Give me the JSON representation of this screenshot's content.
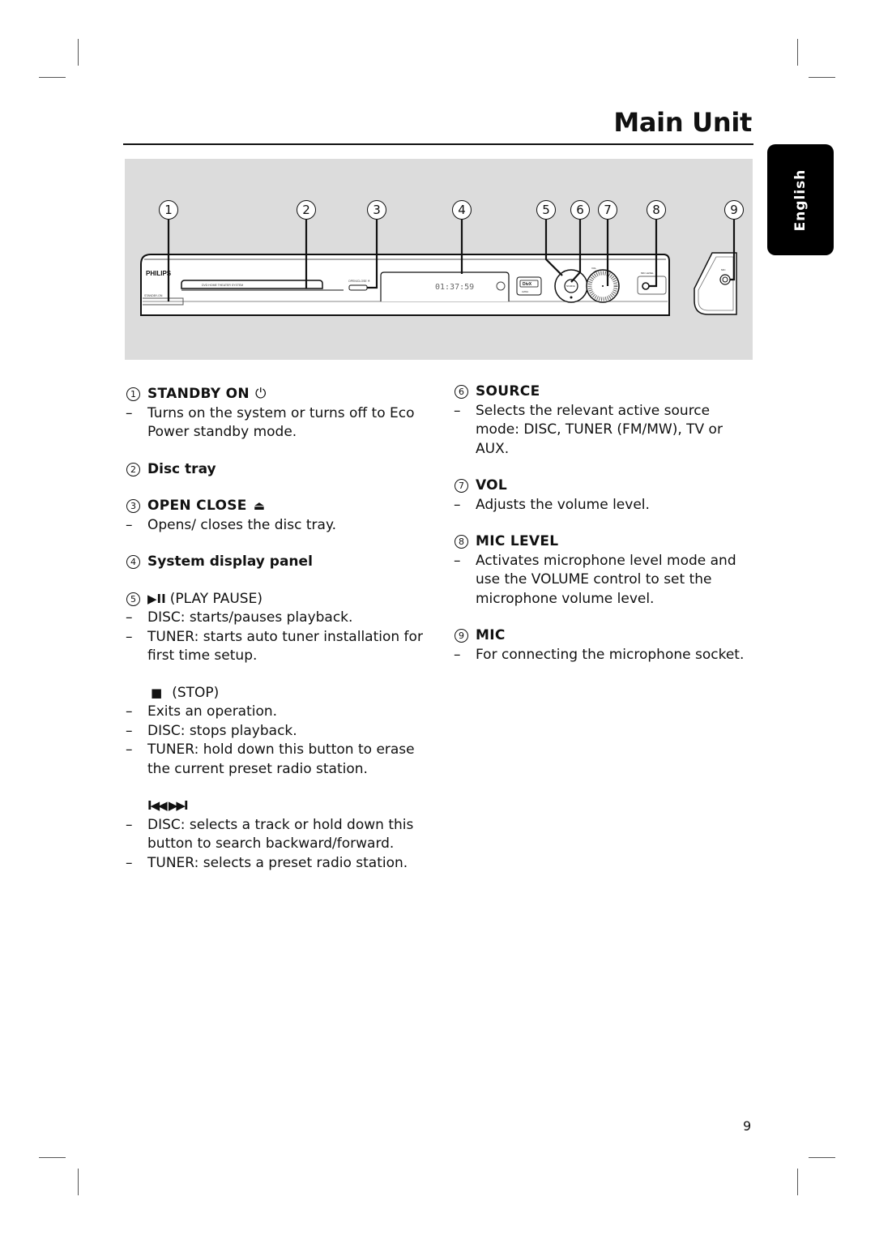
{
  "header": {
    "title": "Main Unit",
    "language_tab": "English"
  },
  "figure": {
    "callouts": [
      "1",
      "2",
      "3",
      "4",
      "5",
      "6",
      "7",
      "8",
      "9"
    ],
    "device_labels": {
      "brand": "PHILIPS",
      "tray_label": "DVD HOME THEATER SYSTEM",
      "standby_label": "STANDBY-ON",
      "open_close_label": "OPEN/CLOSE ≜",
      "display_readout": "01:37:59",
      "divx_label": "DivX",
      "divx_sub": "ULTRA",
      "source_label": "SOURCE",
      "vol_label": "VOL",
      "mic_level_label": "MIC LEVEL",
      "mic_label": "MIC"
    }
  },
  "left_column": {
    "items": [
      {
        "num": "1",
        "label": "STANDBY ON",
        "icon": "power-icon",
        "symbol": "⏻",
        "bullets": [
          "Turns on the system or turns off to Eco Power standby mode."
        ]
      },
      {
        "num": "2",
        "label": "Disc tray",
        "bullets": []
      },
      {
        "num": "3",
        "label": "OPEN CLOSE",
        "icon": "eject-icon",
        "symbol": "⏏",
        "bullets": [
          "Opens/ closes the disc tray."
        ]
      },
      {
        "num": "4",
        "label": "System display panel",
        "bullets": []
      },
      {
        "num": "5",
        "label": "(PLAY PAUSE)",
        "icon": "play-pause-icon",
        "symbol": "▶II",
        "bullets": [
          "DISC: starts/pauses playback.",
          "TUNER: starts auto tuner installation for first time setup."
        ]
      },
      {
        "label": "(STOP)",
        "icon": "stop-icon",
        "symbol": "■",
        "bullets": [
          "Exits an operation.",
          "DISC: stops playback.",
          "TUNER: hold down this button to erase the current preset radio station."
        ]
      },
      {
        "label": "",
        "icon": "skip-prev-next-icon",
        "symbol": "I◀◀ ▶▶I",
        "bullets": [
          "DISC: selects a track or hold down this button to search backward/forward.",
          "TUNER: selects a preset radio station."
        ]
      }
    ]
  },
  "right_column": {
    "items": [
      {
        "num": "6",
        "label": "SOURCE",
        "bullets": [
          "Selects the relevant active source mode: DISC, TUNER (FM/MW), TV or AUX."
        ]
      },
      {
        "num": "7",
        "label": "VOL",
        "bullets": [
          "Adjusts the volume level."
        ]
      },
      {
        "num": "8",
        "label": "MIC LEVEL",
        "bullets": [
          "Activates microphone level mode and use the VOLUME control to set the microphone volume level."
        ]
      },
      {
        "num": "9",
        "label": "MIC",
        "bullets": [
          "For connecting the microphone socket."
        ]
      }
    ]
  },
  "footer": {
    "page_number": "9",
    "dash": "–"
  }
}
